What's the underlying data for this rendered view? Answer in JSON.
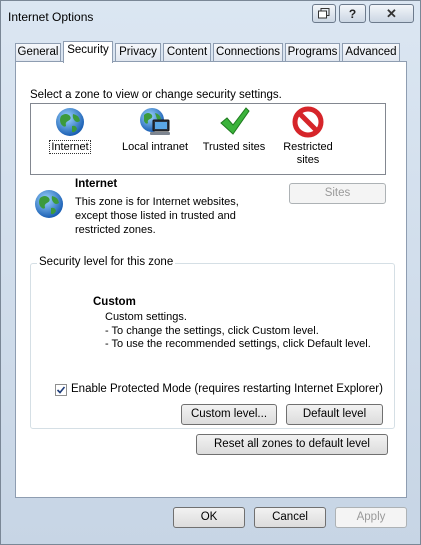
{
  "window": {
    "title": "Internet Options",
    "help_glyph": "?",
    "close_glyph": "✕"
  },
  "tabs": [
    {
      "label": "General"
    },
    {
      "label": "Security",
      "active": true
    },
    {
      "label": "Privacy"
    },
    {
      "label": "Content"
    },
    {
      "label": "Connections"
    },
    {
      "label": "Programs"
    },
    {
      "label": "Advanced"
    }
  ],
  "zones": {
    "instruction": "Select a zone to view or change security settings.",
    "items": [
      {
        "label": "Internet",
        "icon": "globe-icon",
        "selected": true
      },
      {
        "label": "Local intranet",
        "icon": "local-intranet-icon"
      },
      {
        "label": "Trusted sites",
        "icon": "checkmark-icon"
      },
      {
        "label": "Restricted sites",
        "icon": "no-entry-icon"
      }
    ]
  },
  "zone_info": {
    "title": "Internet",
    "description": "This zone is for Internet websites, except those listed in trusted and restricted zones.",
    "sites_button": "Sites",
    "sites_enabled": false
  },
  "security_level": {
    "group_label": "Security level for this zone",
    "level_name": "Custom",
    "lines": [
      "Custom settings.",
      "- To change the settings, click Custom level.",
      "- To use the recommended settings, click Default level."
    ],
    "protected_mode_label": "Enable Protected Mode (requires restarting Internet Explorer)",
    "protected_mode_checked": true,
    "custom_level_button": "Custom level...",
    "default_level_button": "Default level",
    "reset_all_button": "Reset all zones to default level"
  },
  "footer": {
    "ok": "OK",
    "cancel": "Cancel",
    "apply": "Apply",
    "apply_enabled": false
  },
  "colors": {
    "window_bg": "#d4e0ec",
    "panel_bg": "#ffffff",
    "tab_border": "#8e9db1"
  }
}
